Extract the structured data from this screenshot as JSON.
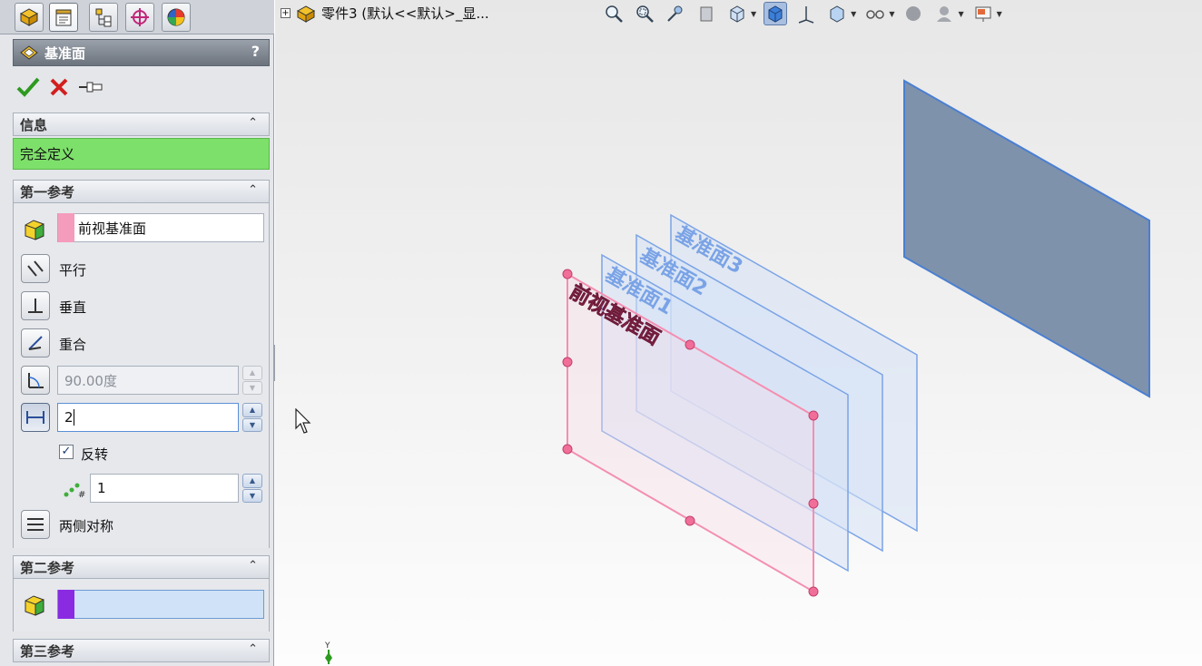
{
  "tabs": [
    {
      "name": "feature-manager"
    },
    {
      "name": "property-manager"
    },
    {
      "name": "configuration-manager"
    },
    {
      "name": "dimxpert-manager"
    },
    {
      "name": "display-manager"
    }
  ],
  "property_manager": {
    "title": "基准面",
    "help": "?",
    "actions": {
      "ok": "ok",
      "cancel": "cancel",
      "pin": "pin"
    }
  },
  "info_section": {
    "heading": "信息",
    "collapse": "⌃",
    "status": "完全定义",
    "status_color": "#7de06a"
  },
  "first_reference": {
    "heading": "第一参考",
    "collapse": "⌃",
    "reference": "前视基准面",
    "swatch_color": "#f59bbb",
    "options": {
      "parallel": "平行",
      "perpendicular": "垂直",
      "coincident": "重合"
    },
    "angle_value": "90.00度",
    "distance_value": "2",
    "flip_label": "反转",
    "flip_checked": "✓",
    "instances_value": "1",
    "mid_plane_label": "两侧对称"
  },
  "second_reference": {
    "heading": "第二参考",
    "collapse": "⌃",
    "reference": "",
    "swatch_color": "#8a2be2"
  },
  "third_reference": {
    "heading": "第三参考",
    "collapse": "⌃"
  },
  "document": {
    "expand": "+",
    "title": "零件3  (默认<<默认>_显..."
  },
  "scene": {
    "planes": [
      {
        "label": "前视基准面",
        "color": "#f48fb1"
      },
      {
        "label": "基准面1",
        "color": "#7aa3e6"
      },
      {
        "label": "基准面2",
        "color": "#7aa3e6"
      },
      {
        "label": "基准面3",
        "color": "#7aa3e6"
      }
    ],
    "selected_plane_color": "#7f92ab",
    "triad_axis": "Y"
  }
}
